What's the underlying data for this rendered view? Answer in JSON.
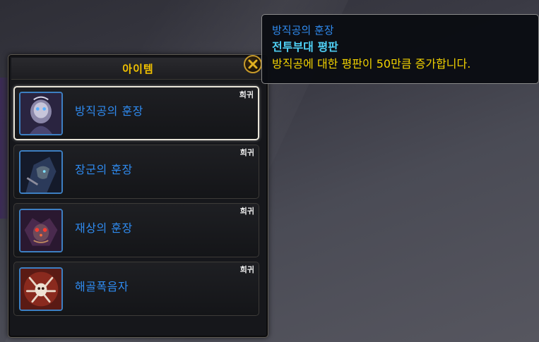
{
  "panel": {
    "title": "아이템"
  },
  "items": [
    {
      "name": "방직공의 훈장",
      "rarity": "희귀",
      "icon": "weaver-portrait-icon",
      "selected": true
    },
    {
      "name": "장군의 훈장",
      "rarity": "희귀",
      "icon": "general-portrait-icon",
      "selected": false
    },
    {
      "name": "재상의 훈장",
      "rarity": "희귀",
      "icon": "vizier-portrait-icon",
      "selected": false
    },
    {
      "name": "해골폭음자",
      "rarity": "희귀",
      "icon": "skull-drinker-icon",
      "selected": false
    }
  ],
  "tooltip": {
    "title": "방직공의 훈장",
    "subtitle": "전투부대 평판",
    "description": "방직공에 대한 평판이 50만큼 증가합니다."
  },
  "colors": {
    "title_gold": "#f2c200",
    "item_blue": "#2f8bf0",
    "subtitle_cyan": "#4fd0f5",
    "desc_yellow": "#f2d200"
  }
}
